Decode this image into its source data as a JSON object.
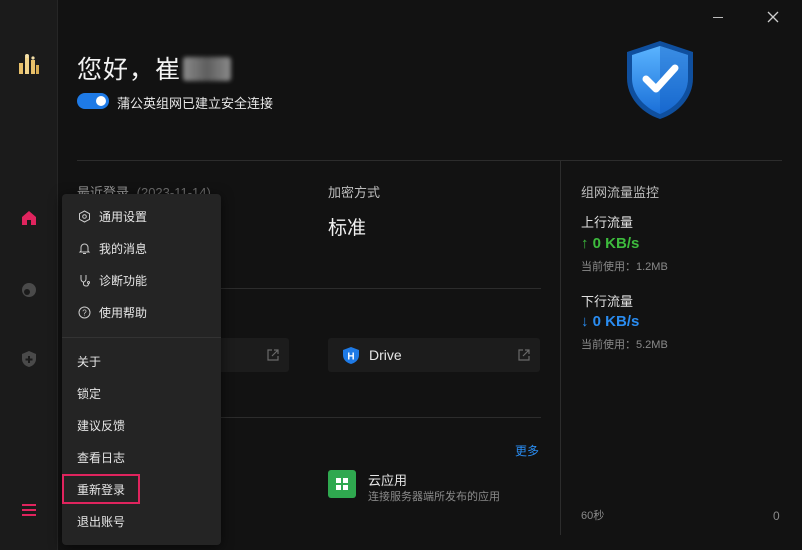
{
  "window": {
    "minimize_icon": "minimize-icon",
    "close_icon": "close-icon"
  },
  "sidebar": {
    "logo_icon": "dandelion-logo-icon",
    "items": [
      {
        "name": "home",
        "icon": "home-icon",
        "active": true
      },
      {
        "name": "network",
        "icon": "network-icon",
        "active": false
      },
      {
        "name": "security",
        "icon": "shield-plus-icon",
        "active": false
      }
    ],
    "menu_icon": "hamburger-menu-icon"
  },
  "header": {
    "greeting": "您好，崔",
    "connection_status": "蒲公英组网已建立安全连接",
    "toggle_on": true
  },
  "info": {
    "last_login_label": "最近登录",
    "last_login_date": "(2023-11-14)",
    "encryption_label": "加密方式",
    "encryption_value": "标准"
  },
  "apps": {
    "drive_label": "Drive",
    "more_label": "更多",
    "cloud_app_title": "云应用",
    "cloud_app_desc": "连接服务器端所发布的应用"
  },
  "traffic": {
    "title": "组网流量监控",
    "up_label": "上行流量",
    "up_value": "↑ 0 KB/s",
    "up_used": "当前使用：1.2MB",
    "down_label": "下行流量",
    "down_value": "↓ 0 KB/s",
    "down_used": "当前使用：5.2MB",
    "axis_left": "60秒",
    "axis_right": "0"
  },
  "menu": {
    "items_with_icons": [
      {
        "label": "通用设置",
        "icon": "settings-hexagon-icon"
      },
      {
        "label": "我的消息",
        "icon": "bell-icon"
      },
      {
        "label": "诊断功能",
        "icon": "stethoscope-icon"
      },
      {
        "label": "使用帮助",
        "icon": "help-circle-icon"
      }
    ],
    "plain_items": [
      "关于",
      "锁定",
      "建议反馈",
      "查看日志",
      "重新登录",
      "退出账号"
    ],
    "highlighted": "重新登录"
  },
  "colors": {
    "accent_blue": "#1e7ae6",
    "active_pink": "#e0245e",
    "up_green": "#3dbb3d",
    "down_blue": "#2a8cf0"
  }
}
